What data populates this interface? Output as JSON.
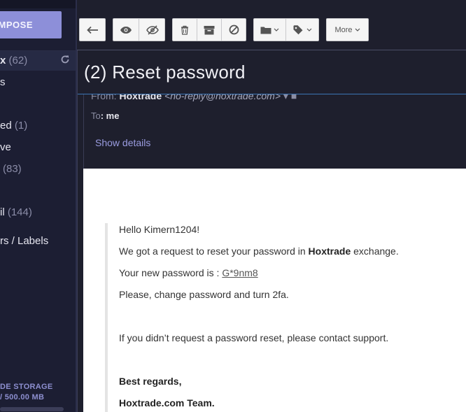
{
  "sidebar": {
    "compose_label": "MPOSE",
    "refresh_icon": "refresh-icon",
    "folders": [
      {
        "name": "x",
        "count": "(62)"
      },
      {
        "name": "s",
        "count": ""
      },
      {
        "name": "ed",
        "count": "(1)"
      },
      {
        "name": "ve",
        "count": ""
      },
      {
        "name": "",
        "count": "(83)"
      },
      {
        "name": "il",
        "count": "(144)"
      },
      {
        "name": "rs / Labels",
        "count": ""
      }
    ],
    "storage_label": "DE STORAGE",
    "storage_value": "/ 500.00 MB"
  },
  "toolbar": {
    "more_label": "More",
    "icons": [
      "back-arrow-icon",
      "eye-icon",
      "eye-slash-icon",
      "trash-icon",
      "archive-icon",
      "block-icon",
      "folder-icon",
      "tag-icon",
      "chevron-down-icon"
    ]
  },
  "message": {
    "title": "(2) Reset password",
    "from_label": "From:",
    "from_name": "Hoxtrade",
    "from_email": "<no-reply@hoxtrade.com>",
    "to_label": "To",
    "to_value": ": me",
    "show_details": "Show details"
  },
  "body": {
    "greeting": "Hello Kimern1204!",
    "line1_pre": "We got a request to reset your password in ",
    "line1_bold": "Hoxtrade",
    "line1_post": " exchange.",
    "line2_pre": "Your new password is : ",
    "password": "G*9nm8",
    "line3": "Please, change password and turn 2fa.",
    "line4": "If you didn’t request a password reset, please contact support.",
    "regards": "Best regards,",
    "team": "Hoxtrade.com  Team."
  }
}
